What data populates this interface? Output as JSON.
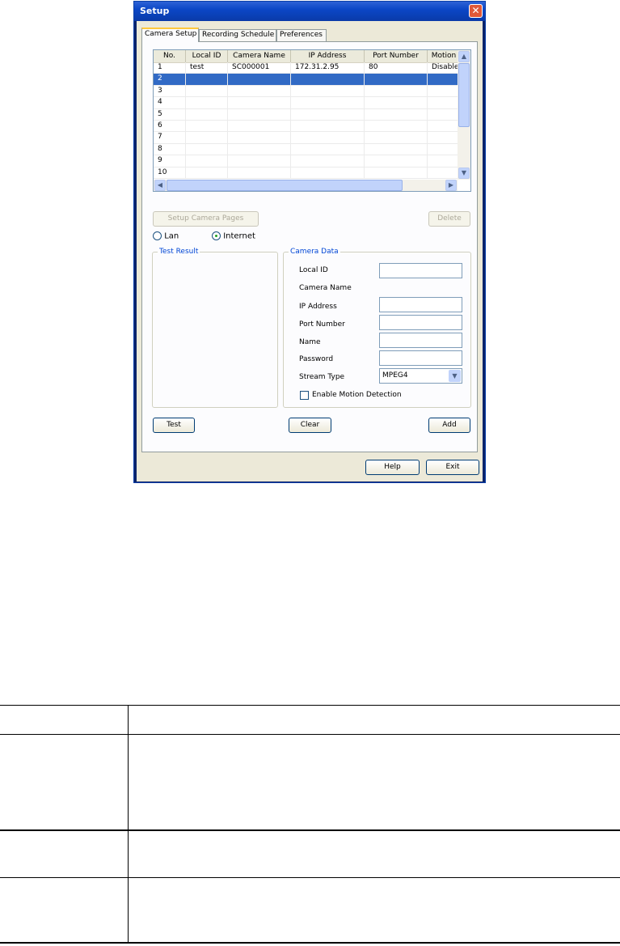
{
  "window": {
    "title": "Setup"
  },
  "tabs": [
    {
      "label": "Camera Setup",
      "active": true
    },
    {
      "label": "Recording Schedule",
      "active": false
    },
    {
      "label": "Preferences",
      "active": false
    }
  ],
  "camera_table": {
    "columns": [
      "No.",
      "Local ID",
      "Camera Name",
      "IP Address",
      "Port Number",
      "Motion"
    ],
    "rows": [
      [
        "1",
        "test",
        "SC000001",
        "172.31.2.95",
        "80",
        "Disable"
      ],
      [
        "2",
        "",
        "",
        "",
        "",
        ""
      ],
      [
        "3",
        "",
        "",
        "",
        "",
        ""
      ],
      [
        "4",
        "",
        "",
        "",
        "",
        ""
      ],
      [
        "5",
        "",
        "",
        "",
        "",
        ""
      ],
      [
        "6",
        "",
        "",
        "",
        "",
        ""
      ],
      [
        "7",
        "",
        "",
        "",
        "",
        ""
      ],
      [
        "8",
        "",
        "",
        "",
        "",
        ""
      ],
      [
        "9",
        "",
        "",
        "",
        "",
        ""
      ],
      [
        "10",
        "",
        "",
        "",
        "",
        ""
      ]
    ],
    "selected_row": 2
  },
  "buttons": {
    "setup_camera_pages": "Setup Camera Pages",
    "delete": "Delete",
    "test": "Test",
    "clear": "Clear",
    "add": "Add",
    "help": "Help",
    "exit": "Exit"
  },
  "connection": {
    "lan": "Lan",
    "internet": "Internet",
    "selected": "Internet"
  },
  "test_result": {
    "title": "Test Result"
  },
  "camera_data": {
    "title": "Camera Data",
    "local_id_label": "Local ID",
    "camera_name_label": "Camera Name",
    "ip_address_label": "IP Address",
    "port_number_label": "Port Number",
    "name_label": "Name",
    "password_label": "Password",
    "stream_type_label": "Stream Type",
    "stream_type_value": "MPEG4",
    "motion_detection_label": "Enable Motion Detection",
    "motion_detection_checked": false
  }
}
